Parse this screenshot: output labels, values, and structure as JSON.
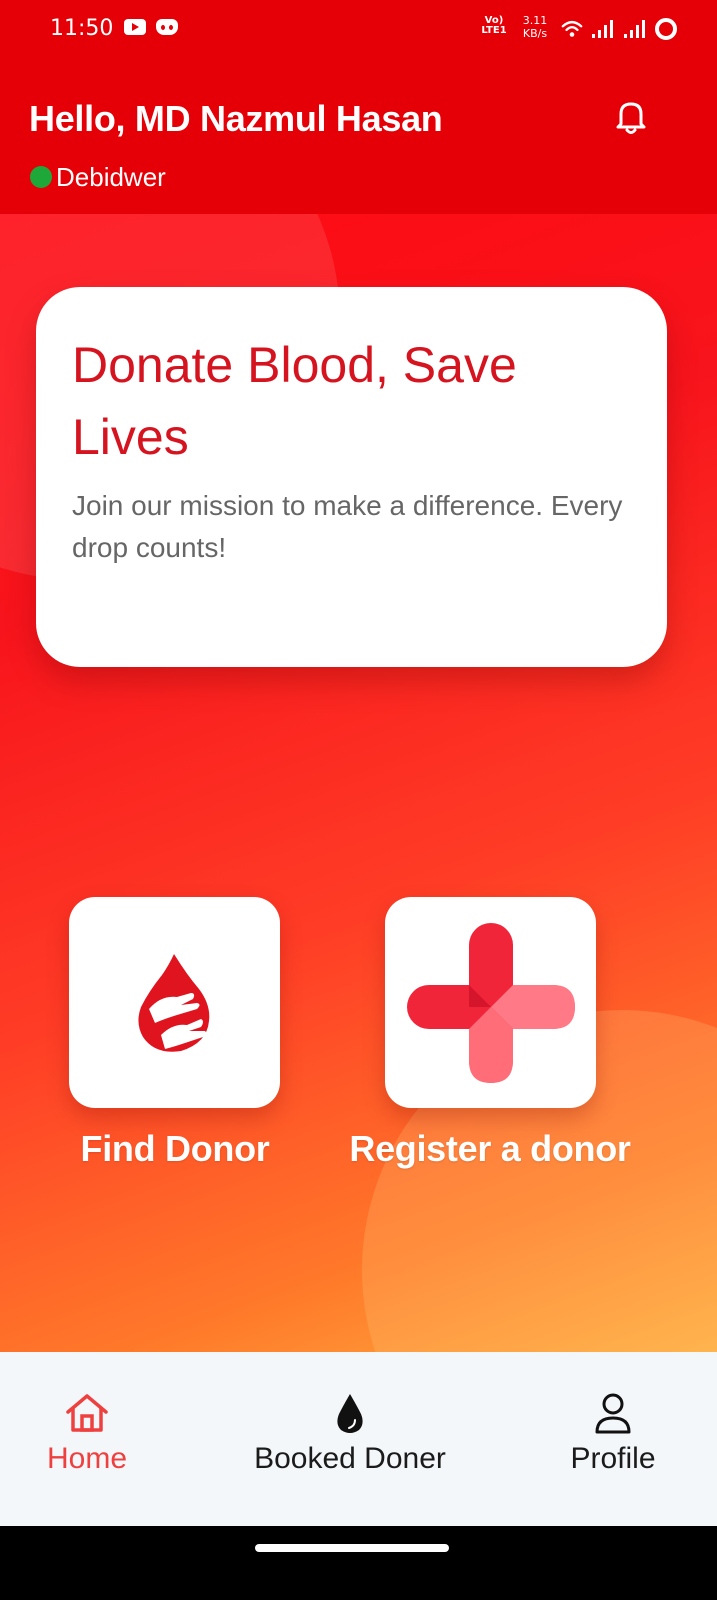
{
  "status_bar": {
    "time": "11:50",
    "network_type": "Vo) LTE1",
    "net_speed_value": "3.11",
    "net_speed_unit": "KB/s",
    "icons": [
      "youtube-icon",
      "discord-icon",
      "wifi-icon",
      "signal-icon",
      "signal-icon",
      "battery-ring-icon"
    ]
  },
  "header": {
    "greeting": "Hello, MD Nazmul Hasan",
    "location": "Debidwer",
    "online_color": "#1fa83a",
    "notification_icon": "bell-icon"
  },
  "hero": {
    "title": "Donate Blood, Save Lives",
    "subtitle": "Join our mission to make a difference. Every drop counts!"
  },
  "actions": [
    {
      "label": "Find Donor",
      "icon": "blood-drop-hands-icon"
    },
    {
      "label": "Register a donor",
      "icon": "medical-cross-icon"
    }
  ],
  "bottom_nav": {
    "items": [
      {
        "label": "Home",
        "icon": "home-icon",
        "active": true
      },
      {
        "label": "Booked Doner",
        "icon": "drop-icon",
        "active": false
      },
      {
        "label": "Profile",
        "icon": "person-icon",
        "active": false
      }
    ]
  },
  "colors": {
    "header_red": "#e40006",
    "accent_red": "#d6141f",
    "nav_active": "#ef4040",
    "nav_bg": "#f3f7fa"
  }
}
